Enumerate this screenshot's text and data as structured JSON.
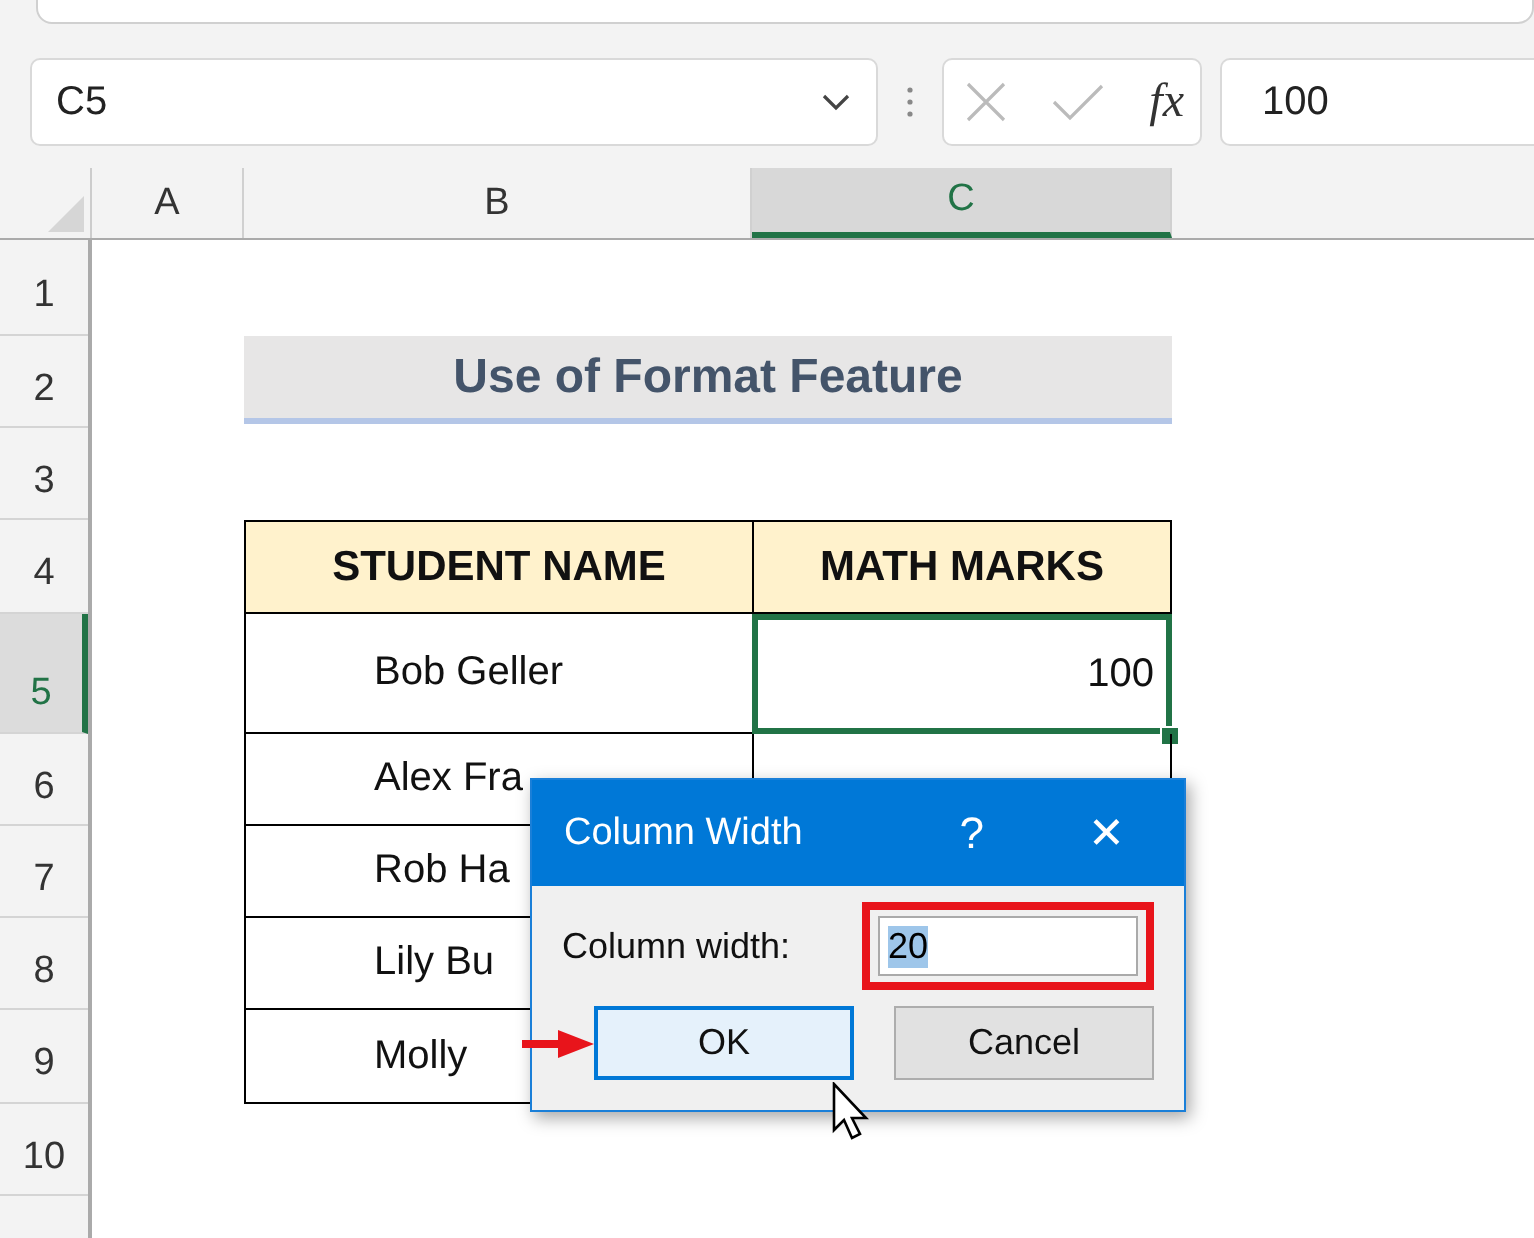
{
  "formula_bar": {
    "name_box": "C5",
    "fx": "fx",
    "value": "100"
  },
  "columns": [
    {
      "label": "A",
      "selected": false
    },
    {
      "label": "B",
      "selected": false
    },
    {
      "label": "C",
      "selected": true
    }
  ],
  "rows": [
    {
      "label": "1",
      "selected": false
    },
    {
      "label": "2",
      "selected": false
    },
    {
      "label": "3",
      "selected": false
    },
    {
      "label": "4",
      "selected": false
    },
    {
      "label": "5",
      "selected": true
    },
    {
      "label": "6",
      "selected": false
    },
    {
      "label": "7",
      "selected": false
    },
    {
      "label": "8",
      "selected": false
    },
    {
      "label": "9",
      "selected": false
    },
    {
      "label": "10",
      "selected": false
    }
  ],
  "title": "Use of Format Feature",
  "table": {
    "columns": [
      "STUDENT NAME",
      "MATH MARKS"
    ],
    "rows": [
      {
        "name": "Bob Geller",
        "marks": "100"
      },
      {
        "name": "Alex Fra"
      },
      {
        "name": "Rob Ha"
      },
      {
        "name": "Lily Bu"
      },
      {
        "name": "Molly"
      }
    ]
  },
  "dialog": {
    "title": "Column Width",
    "help": "?",
    "close": "✕",
    "field_label": "Column width:",
    "field_value": "20",
    "buttons": [
      {
        "label": "OK",
        "default": true
      },
      {
        "label": "Cancel",
        "default": false
      }
    ]
  }
}
